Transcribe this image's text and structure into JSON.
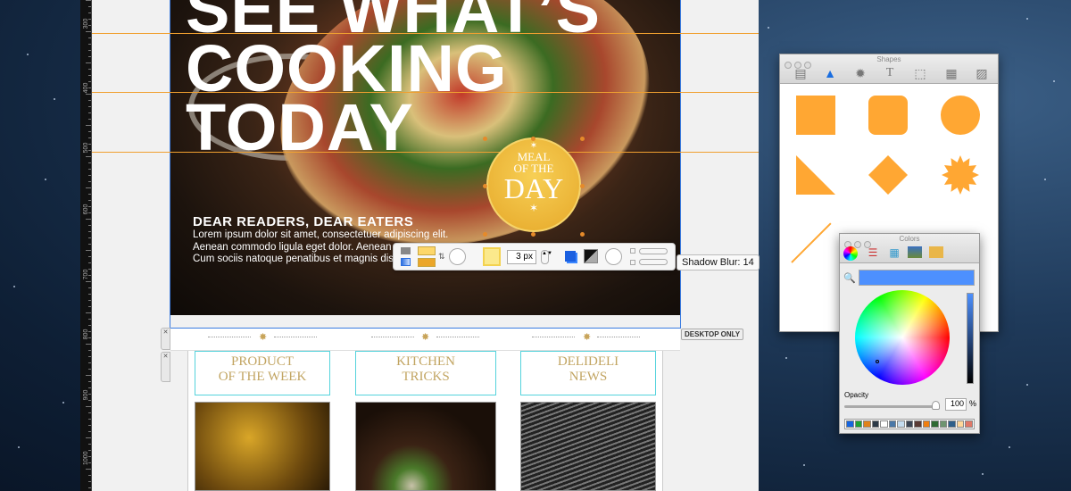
{
  "ruler": {
    "labels": [
      "300",
      "400",
      "500",
      "600",
      "700",
      "800",
      "900",
      "1000"
    ]
  },
  "hero": {
    "headline": [
      "SEE WHAT’S",
      "COOKING",
      "TODAY"
    ],
    "badge": {
      "line1": "MEAL",
      "line2": "OF THE",
      "line3": "DAY"
    },
    "intro_title": "DEAR READERS, DEAR EATERS",
    "intro_lines": [
      "Lorem ipsum dolor sit amet, consectetuer adipiscing elit.",
      "Aenean commodo ligula eget dolor. Aenean ma",
      "Cum sociis natoque penatibus et magnis dis pa"
    ]
  },
  "toolbar": {
    "border_width": "3 px",
    "tooltip": "Shadow Blur: 14"
  },
  "strip": {
    "badge": "DESKTOP ONLY",
    "handle_icon": "close-icon"
  },
  "cards": [
    {
      "line1": "PRODUCT",
      "line2": "OF THE WEEK"
    },
    {
      "line1": "KITCHEN",
      "line2": "TRICKS"
    },
    {
      "line1": "DELIDELI",
      "line2": "NEWS"
    }
  ],
  "shapes_window": {
    "title": "Shapes",
    "tabs": [
      "layout-icon",
      "shape-icon",
      "burst-icon",
      "text-icon",
      "selection-icon",
      "pattern-icon",
      "image-icon"
    ],
    "shape_color": "#ffa733",
    "shapes": [
      "square",
      "rounded-square",
      "circle",
      "right-triangle",
      "diamond",
      "starburst",
      "line"
    ]
  },
  "colors_window": {
    "title": "Colors",
    "selected_color": "#4d90fe",
    "opacity_label": "Opacity",
    "opacity_value": "100",
    "opacity_unit": "%",
    "swatches": [
      "#1665e0",
      "#1fa335",
      "#e0821a",
      "#2c3a48",
      "#ffffff",
      "#4a78a8",
      "#c5dcef",
      "#3c4656",
      "#5a3a34",
      "#f07f10",
      "#2f6a33",
      "#6e9470",
      "#2f5f8a",
      "#ffd79a",
      "#e07868"
    ]
  },
  "colors": {
    "accent": "#3a7be0",
    "guide": "#f0a030",
    "gold": "#c2a562",
    "cyan": "#55d3dc"
  }
}
